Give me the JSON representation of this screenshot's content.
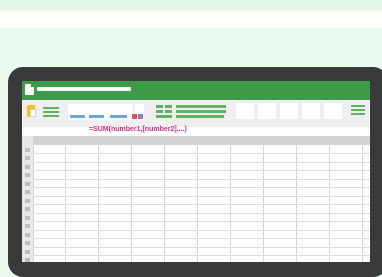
{
  "colors": {
    "background": "#ecfbef",
    "device_frame": "#3a3a3a",
    "app_green": "#3e9b47",
    "icon_green": "#5fb55f",
    "formula_pink": "#e0287d",
    "paste_yellow": "#f5c518",
    "blue_accent": "#6aa8dc"
  },
  "formula_bar": {
    "text": "=SUM(number1,[number2],...)"
  },
  "icons": {
    "app": "spreadsheet-app-icon",
    "paste": "clipboard-paste-icon",
    "menu": "hamburger-menu-icon"
  }
}
